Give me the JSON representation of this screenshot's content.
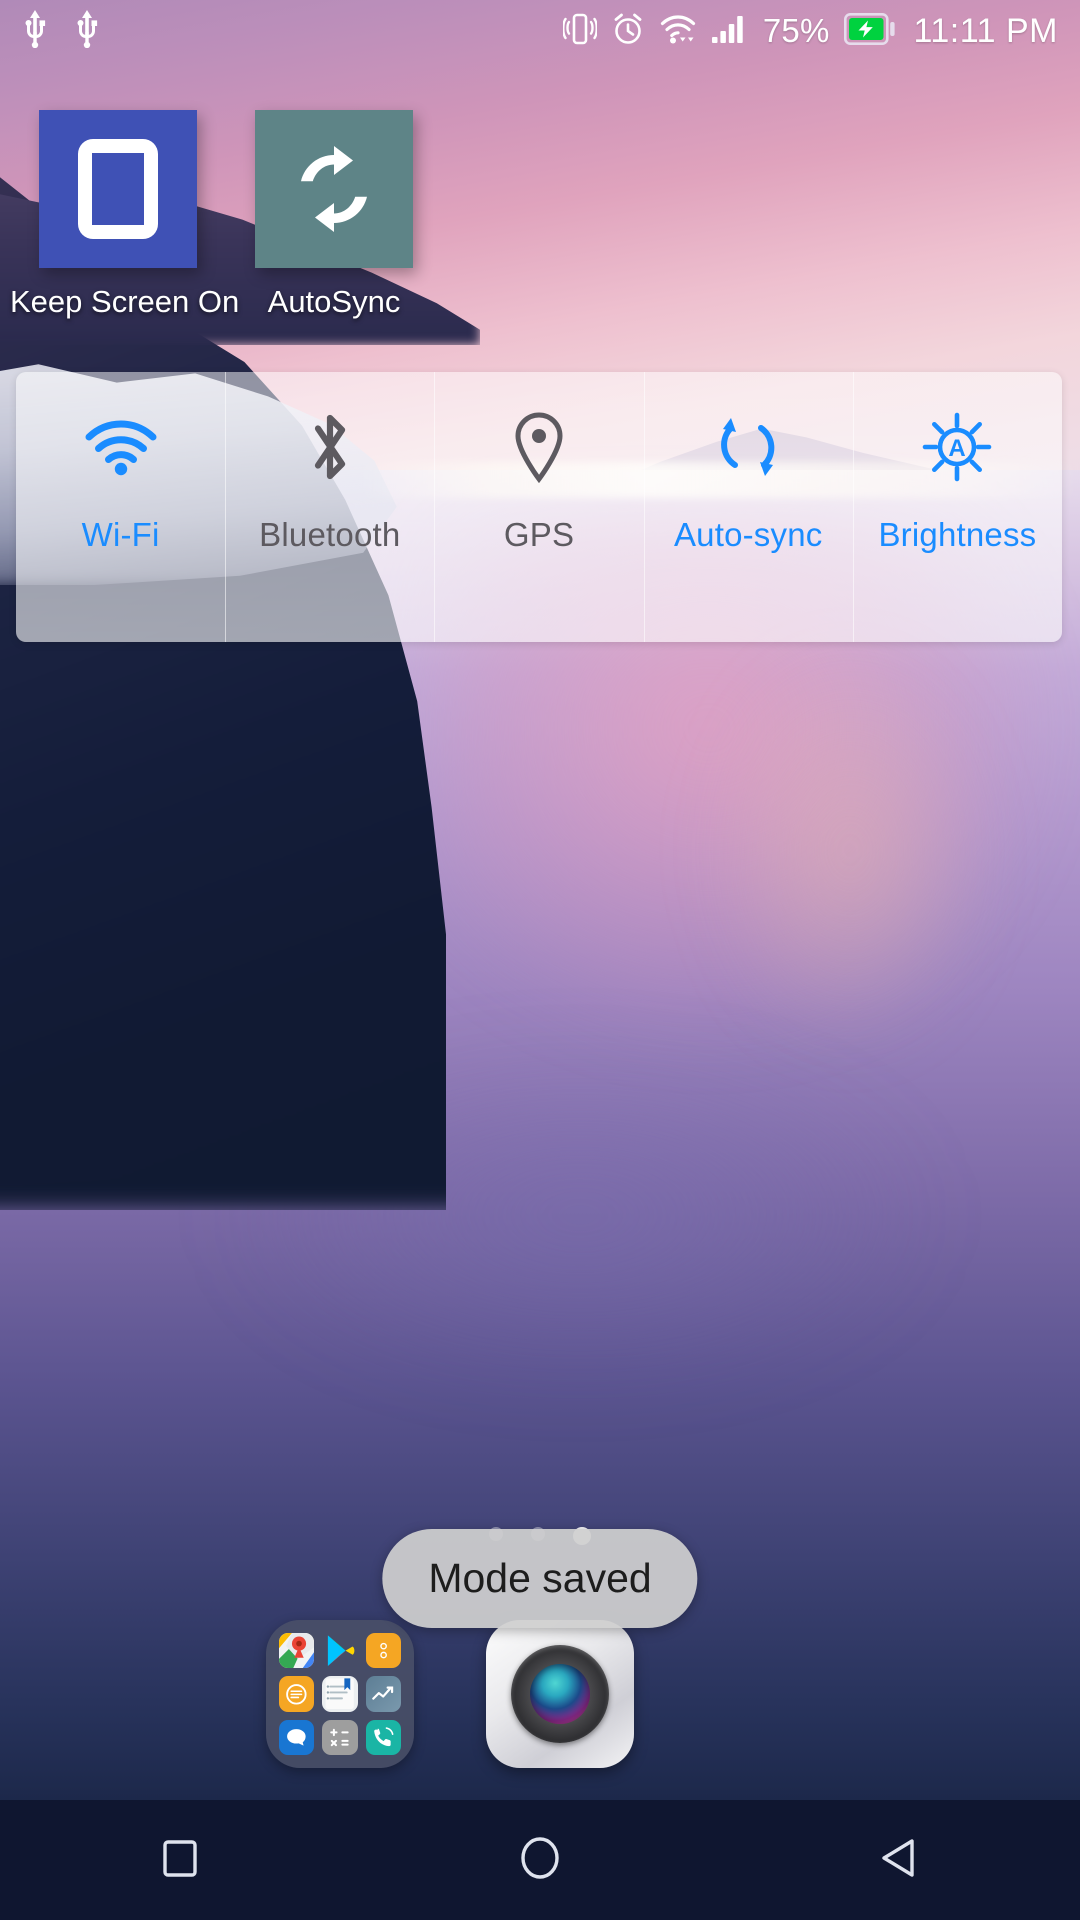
{
  "status_bar": {
    "left_icons": [
      "usb-icon",
      "usb-icon"
    ],
    "right_icons": [
      "vibrate-icon",
      "alarm-icon",
      "wifi-data-icon",
      "signal-bars-icon"
    ],
    "battery_percent": "75%",
    "battery_icon": "battery-charging-icon",
    "battery_color": "#00d23f",
    "time": "11:11 PM"
  },
  "home_apps": [
    {
      "label": "Keep Screen On",
      "icon": "phone-screen-icon",
      "bg": "#3f51b5"
    },
    {
      "label": "AutoSync",
      "icon": "sync-arrows-icon",
      "bg": "#5e8487"
    }
  ],
  "toggle_widget": {
    "tiles": [
      {
        "label": "Wi-Fi",
        "icon": "wifi-icon",
        "state": "on",
        "color": "#1a8cff"
      },
      {
        "label": "Bluetooth",
        "icon": "bluetooth-icon",
        "state": "off",
        "color": "#5d5a60"
      },
      {
        "label": "GPS",
        "icon": "location-pin-icon",
        "state": "off",
        "color": "#5d5a60"
      },
      {
        "label": "Auto-sync",
        "icon": "sync-icon",
        "state": "on",
        "color": "#1a8cff"
      },
      {
        "label": "Brightness",
        "icon": "auto-brightness-icon",
        "state": "on",
        "color": "#1a8cff"
      }
    ]
  },
  "page_indicator": {
    "count": 3,
    "active_index": 2
  },
  "toast": {
    "message": "Mode saved"
  },
  "dock": {
    "folder": {
      "name": "app-folder",
      "apps": [
        "google-maps-icon",
        "play-store-icon",
        "settings-orange-icon",
        "notes-orange-icon",
        "notepad-icon",
        "stocks-chart-icon",
        "messages-icon",
        "calculator-icon",
        "phone-icon"
      ]
    },
    "camera": {
      "label": "camera-app",
      "icon": "camera-lens-icon"
    }
  },
  "nav_bar": {
    "buttons": [
      {
        "name": "recents",
        "icon": "square-icon"
      },
      {
        "name": "home",
        "icon": "circle-icon"
      },
      {
        "name": "back",
        "icon": "triangle-left-icon"
      }
    ]
  }
}
